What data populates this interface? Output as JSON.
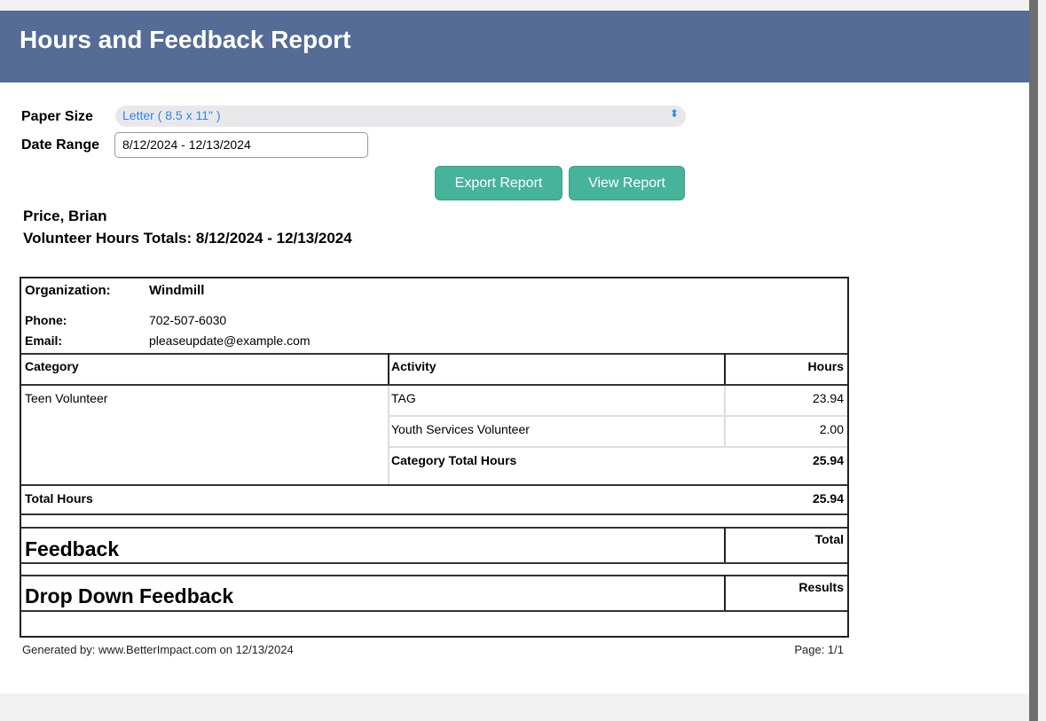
{
  "header": {
    "title": "Hours and Feedback Report"
  },
  "form": {
    "paper_size_label": "Paper Size",
    "paper_size_value": "Letter ( 8.5 x 11\" )",
    "date_range_label": "Date Range",
    "date_range_value": "8/12/2024 - 12/13/2024",
    "export_button": "Export Report",
    "view_button": "View Report"
  },
  "report": {
    "name": "Price, Brian",
    "totals_heading": "Volunteer Hours Totals: 8/12/2024 - 12/13/2024",
    "org_label": "Organization:",
    "org_value": "Windmill",
    "phone_label": "Phone:",
    "phone_value": "702-507-6030",
    "email_label": "Email:",
    "email_value": "pleaseupdate@example.com",
    "columns": [
      "Category",
      "Activity",
      "Hours"
    ],
    "category": "Teen Volunteer",
    "rows": [
      {
        "activity": "TAG",
        "hours": "23.94"
      },
      {
        "activity": "Youth Services Volunteer",
        "hours": "2.00"
      }
    ],
    "category_total_label": "Category Total Hours",
    "category_total": "25.94",
    "total_hours_label": "Total Hours",
    "total_hours": "25.94",
    "feedback_title": "Feedback",
    "feedback_col": "Total",
    "dropdown_title": "Drop Down Feedback",
    "dropdown_col": "Results",
    "footer_generated": "Generated by: www.BetterImpact.com on 12/13/2024",
    "footer_page": "Page: 1/1"
  }
}
